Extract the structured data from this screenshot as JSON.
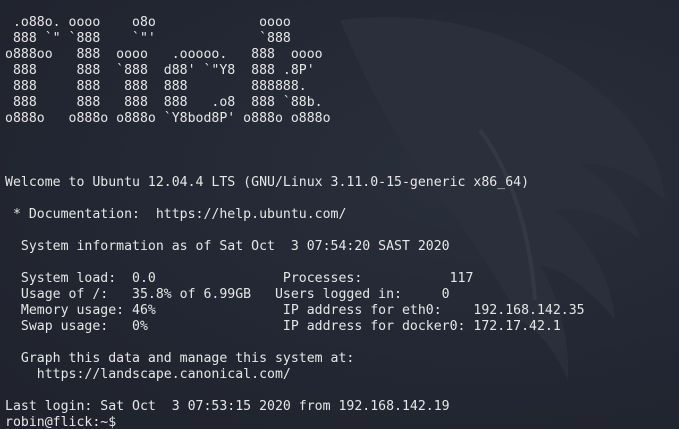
{
  "logo": [
    " .o88o. oooo    o8o             oooo",
    " 888 `\" `888    `\"'             `888",
    "o888oo   888  oooo   .ooooo.   888  oooo",
    " 888     888  `888  d88' `\"Y8  888 .8P'",
    " 888     888   888  888        888888.",
    " 888     888   888  888   .o8  888 `88b.",
    "o888o   o888o o888o `Y8bod8P' o888o o888o"
  ],
  "welcome": "Welcome to Ubuntu 12.04.4 LTS (GNU/Linux 3.11.0-15-generic x86_64)",
  "documentation": " * Documentation:  https://help.ubuntu.com/",
  "sysinfo_header": "  System information as of Sat Oct  3 07:54:20 SAST 2020",
  "stats": [
    "  System load:  0.0                Processes:           117",
    "  Usage of /:   35.8% of 6.99GB   Users logged in:     0",
    "  Memory usage: 46%                IP address for eth0:    192.168.142.35",
    "  Swap usage:   0%                 IP address for docker0: 172.17.42.1"
  ],
  "graph_line1": "  Graph this data and manage this system at:",
  "graph_line2": "    https://landscape.canonical.com/",
  "last_login": "Last login: Sat Oct  3 07:53:15 2020 from 192.168.142.19",
  "prompt": "robin@flick:~$ ",
  "colors": {
    "background": "#232733",
    "text": "#e6e6e6",
    "cursor": "#f2f2f2",
    "watermark": "#2f3442"
  },
  "icons": {
    "watermark": "kali-dragon-icon"
  }
}
